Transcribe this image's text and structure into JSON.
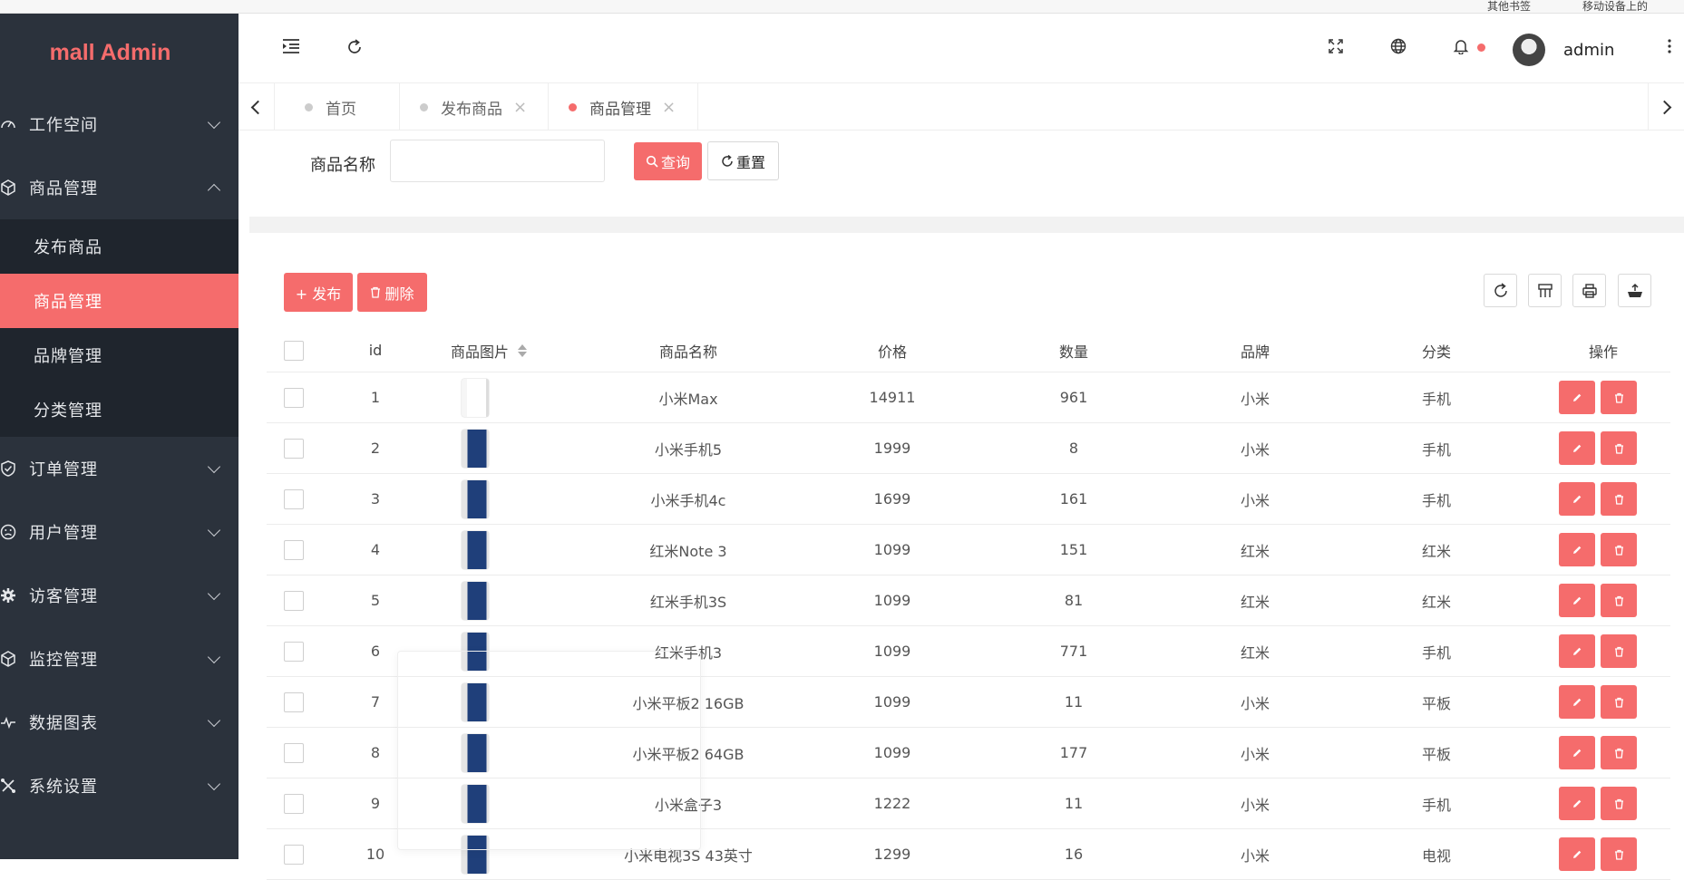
{
  "app": {
    "title": "mall Admin"
  },
  "browser": {
    "bookmarks": [
      "其他书签",
      "移动设备上的"
    ]
  },
  "sidebar": {
    "menus": [
      {
        "label": "工作空间",
        "icon": "dashboard-icon",
        "expanded": false
      },
      {
        "label": "商品管理",
        "icon": "box-icon",
        "expanded": true,
        "children": [
          {
            "label": "发布商品",
            "active": false
          },
          {
            "label": "商品管理",
            "active": true
          },
          {
            "label": "品牌管理",
            "active": false
          },
          {
            "label": "分类管理",
            "active": false
          }
        ]
      },
      {
        "label": "订单管理",
        "icon": "shield-check-icon",
        "expanded": false
      },
      {
        "label": "用户管理",
        "icon": "smile-icon",
        "expanded": false
      },
      {
        "label": "访客管理",
        "icon": "gear-icon",
        "expanded": false
      },
      {
        "label": "监控管理",
        "icon": "box-icon",
        "expanded": false
      },
      {
        "label": "数据图表",
        "icon": "pulse-icon",
        "expanded": false
      },
      {
        "label": "系统设置",
        "icon": "tools-icon",
        "expanded": false
      }
    ]
  },
  "header": {
    "user": "admin",
    "icons": [
      "menu-fold-icon",
      "refresh-icon",
      "fullscreen-icon",
      "globe-icon",
      "bell-icon",
      "more-vertical-icon"
    ]
  },
  "tabs": [
    {
      "label": "首页",
      "closable": false,
      "active": false
    },
    {
      "label": "发布商品",
      "closable": true,
      "active": false
    },
    {
      "label": "商品管理",
      "closable": true,
      "active": true
    }
  ],
  "search": {
    "label": "商品名称",
    "value": "",
    "query_label": "查询",
    "reset_label": "重置"
  },
  "toolbar": {
    "publish_label": "+ 发布",
    "delete_label": "删除"
  },
  "colors": {
    "accent": "#f56c6c",
    "sidebar": "#2b323c",
    "sidebar_sub": "#1f252d"
  },
  "table": {
    "columns": [
      "id",
      "商品图片",
      "商品名称",
      "价格",
      "数量",
      "品牌",
      "分类",
      "操作"
    ],
    "rows": [
      {
        "id": "1",
        "name": "小米Max",
        "price": "14911",
        "qty": "961",
        "brand": "小米",
        "category": "手机"
      },
      {
        "id": "2",
        "name": "小米手机5",
        "price": "1999",
        "qty": "8",
        "brand": "小米",
        "category": "手机"
      },
      {
        "id": "3",
        "name": "小米手机4c",
        "price": "1699",
        "qty": "161",
        "brand": "小米",
        "category": "手机"
      },
      {
        "id": "4",
        "name": "红米Note 3",
        "price": "1099",
        "qty": "151",
        "brand": "红米",
        "category": "红米"
      },
      {
        "id": "5",
        "name": "红米手机3S",
        "price": "1099",
        "qty": "81",
        "brand": "红米",
        "category": "红米"
      },
      {
        "id": "6",
        "name": "红米手机3",
        "price": "1099",
        "qty": "771",
        "brand": "红米",
        "category": "手机"
      },
      {
        "id": "7",
        "name": "小米平板2 16GB",
        "price": "1099",
        "qty": "11",
        "brand": "小米",
        "category": "平板"
      },
      {
        "id": "8",
        "name": "小米平板2 64GB",
        "price": "1099",
        "qty": "177",
        "brand": "小米",
        "category": "平板"
      },
      {
        "id": "9",
        "name": "小米盒子3",
        "price": "1222",
        "qty": "11",
        "brand": "小米",
        "category": "手机"
      },
      {
        "id": "10",
        "name": "小米电视3S 43英寸",
        "price": "1299",
        "qty": "16",
        "brand": "小米",
        "category": "电视"
      }
    ]
  }
}
